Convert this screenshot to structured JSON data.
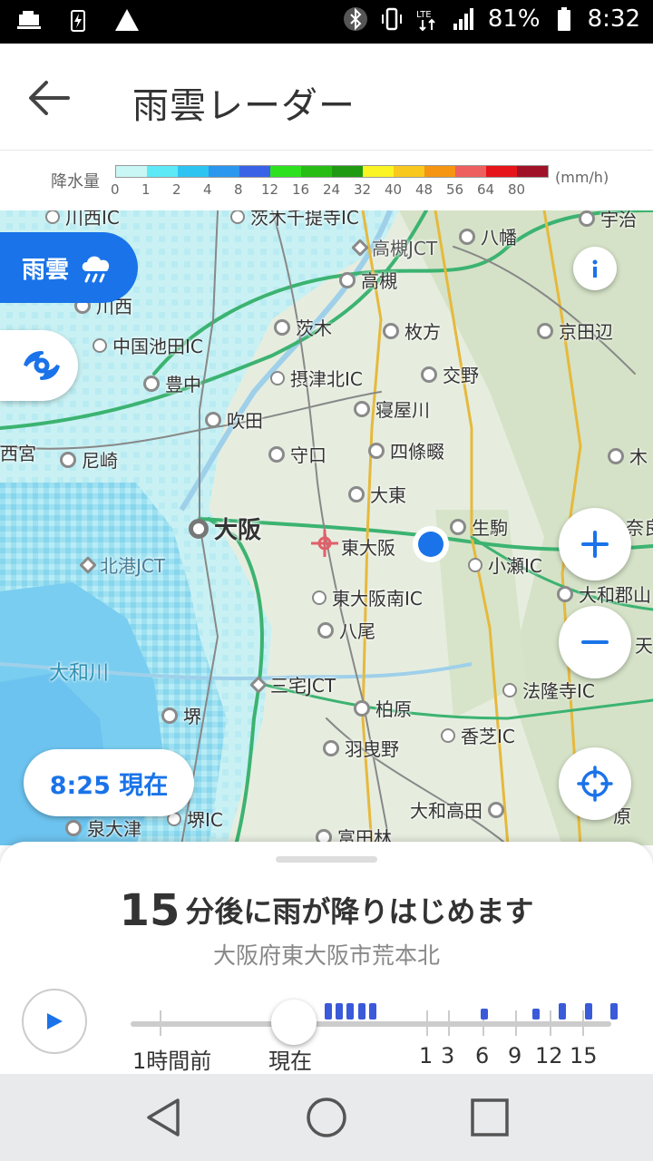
{
  "status_bar": {
    "battery": "81%",
    "time": "8:32",
    "network": "LTE"
  },
  "header": {
    "title": "雨雲レーダー",
    "back_icon": "arrow-left-icon"
  },
  "legend": {
    "label": "降水量",
    "unit": "(mm/h)",
    "ticks": [
      "0",
      "1",
      "2",
      "4",
      "8",
      "12",
      "16",
      "24",
      "32",
      "40",
      "48",
      "56",
      "64",
      "80"
    ],
    "colors": [
      "#c8f7f5",
      "#5ee9f7",
      "#2ec4f2",
      "#2b97ee",
      "#3a62e6",
      "#2ee11f",
      "#27bd15",
      "#1f9a12",
      "#fbf425",
      "#f8c81e",
      "#f59513",
      "#ee5f5f",
      "#e5151a",
      "#a01228"
    ]
  },
  "map": {
    "places": [
      {
        "name": "川西IC",
        "type": "ic"
      },
      {
        "name": "茨木千提寺IC",
        "type": "ic"
      },
      {
        "name": "高槻JCT",
        "type": "jct"
      },
      {
        "name": "八幡",
        "type": "city"
      },
      {
        "name": "宇治",
        "type": "city"
      },
      {
        "name": "高槻",
        "type": "city"
      },
      {
        "name": "川西",
        "type": "city"
      },
      {
        "name": "茨木",
        "type": "city"
      },
      {
        "name": "枚方",
        "type": "city"
      },
      {
        "name": "京田辺",
        "type": "city"
      },
      {
        "name": "中国池田IC",
        "type": "ic"
      },
      {
        "name": "豊中",
        "type": "city"
      },
      {
        "name": "摂津北IC",
        "type": "ic"
      },
      {
        "name": "交野",
        "type": "city"
      },
      {
        "name": "寝屋川",
        "type": "city"
      },
      {
        "name": "吹田",
        "type": "city"
      },
      {
        "name": "西宮",
        "type": "city"
      },
      {
        "name": "尼崎",
        "type": "city"
      },
      {
        "name": "守口",
        "type": "city"
      },
      {
        "name": "四條畷",
        "type": "city"
      },
      {
        "name": "木",
        "type": "city"
      },
      {
        "name": "大東",
        "type": "city"
      },
      {
        "name": "大阪",
        "type": "major"
      },
      {
        "name": "生駒",
        "type": "city"
      },
      {
        "name": "奈良",
        "type": "city"
      },
      {
        "name": "東大阪",
        "type": "center"
      },
      {
        "name": "北港JCT",
        "type": "jct"
      },
      {
        "name": "小瀬IC",
        "type": "ic"
      },
      {
        "name": "東大阪南IC",
        "type": "ic"
      },
      {
        "name": "大和郡山",
        "type": "city"
      },
      {
        "name": "八尾",
        "type": "city"
      },
      {
        "name": "天",
        "type": "city"
      },
      {
        "name": "大和川",
        "type": "river"
      },
      {
        "name": "三宅JCT",
        "type": "jct"
      },
      {
        "name": "法隆寺IC",
        "type": "ic"
      },
      {
        "name": "堺",
        "type": "city"
      },
      {
        "name": "柏原",
        "type": "city"
      },
      {
        "name": "香芝IC",
        "type": "ic"
      },
      {
        "name": "羽曳野",
        "type": "city"
      },
      {
        "name": "大和高田",
        "type": "city"
      },
      {
        "name": "原",
        "type": "city"
      },
      {
        "name": "泉大津",
        "type": "city"
      },
      {
        "name": "堺IC",
        "type": "ic"
      },
      {
        "name": "富田林",
        "type": "city"
      }
    ],
    "amagumo_label": "雨雲",
    "time_chip": "8:25 現在",
    "info_icon": "info-icon",
    "zoom_in_icon": "plus-icon",
    "zoom_out_icon": "minus-icon",
    "locate_icon": "crosshair-icon",
    "typhoon_icon": "typhoon-icon",
    "rain_icon": "cloud-rain-icon"
  },
  "sheet": {
    "headline_number": "15",
    "headline_text": "分後に雨が降りはじめます",
    "location": "大阪府東大阪市荒本北",
    "play_icon": "play-icon",
    "timeline": {
      "labels": [
        "1時間前",
        "現在",
        "1",
        "3",
        "6",
        "9",
        "12",
        "15"
      ],
      "rain_values": [
        3,
        3,
        3,
        3,
        3,
        0,
        2,
        0,
        2,
        3,
        3,
        3
      ]
    }
  },
  "nav": {
    "back": "triangle-back-icon",
    "home": "circle-home-icon",
    "recents": "square-recents-icon"
  }
}
